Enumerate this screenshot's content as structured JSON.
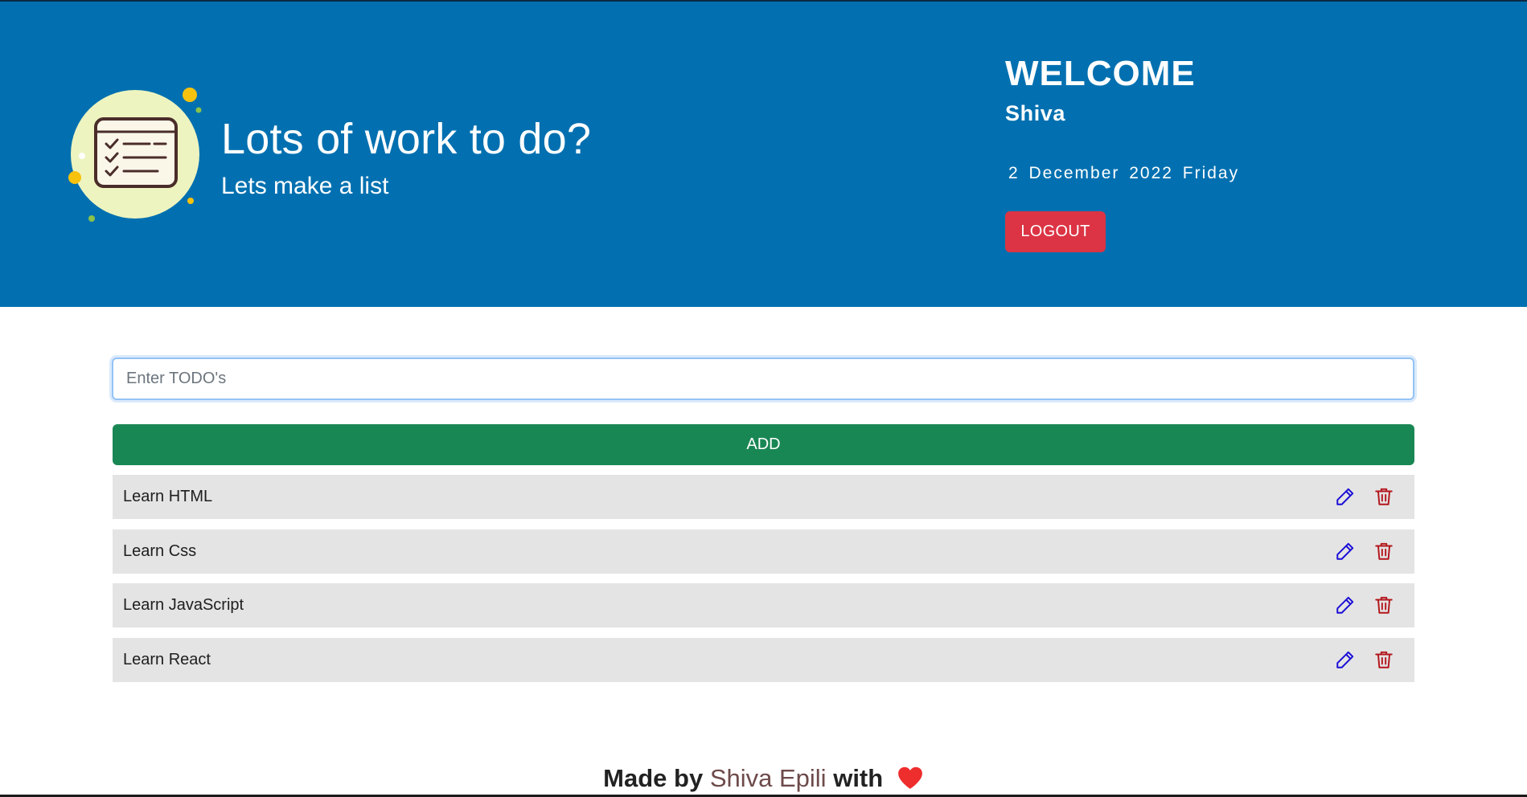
{
  "header": {
    "title": "Lots of work to do?",
    "subtitle": "Lets make a list",
    "welcome": "WELCOME",
    "username": "Shiva",
    "date": "2 December 2022 Friday",
    "logout_label": "LOGOUT"
  },
  "form": {
    "input_placeholder": "Enter TODO's",
    "input_value": "",
    "add_label": "ADD"
  },
  "todos": [
    {
      "text": "Learn HTML"
    },
    {
      "text": "Learn Css"
    },
    {
      "text": "Learn JavaScript"
    },
    {
      "text": "Learn React"
    }
  ],
  "icons": {
    "logo": "checklist-icon",
    "edit": "pencil-icon",
    "delete": "trash-icon",
    "heart": "heart-icon"
  },
  "footer": {
    "made_by": "Made by",
    "author": "Shiva Epili",
    "with": "with"
  },
  "colors": {
    "header_bg": "#0270b0",
    "logout": "#dc3444",
    "add": "#198754",
    "edit_icon": "#1a0dd6",
    "delete_icon": "#b3161c",
    "heart": "#ee2d2d"
  }
}
